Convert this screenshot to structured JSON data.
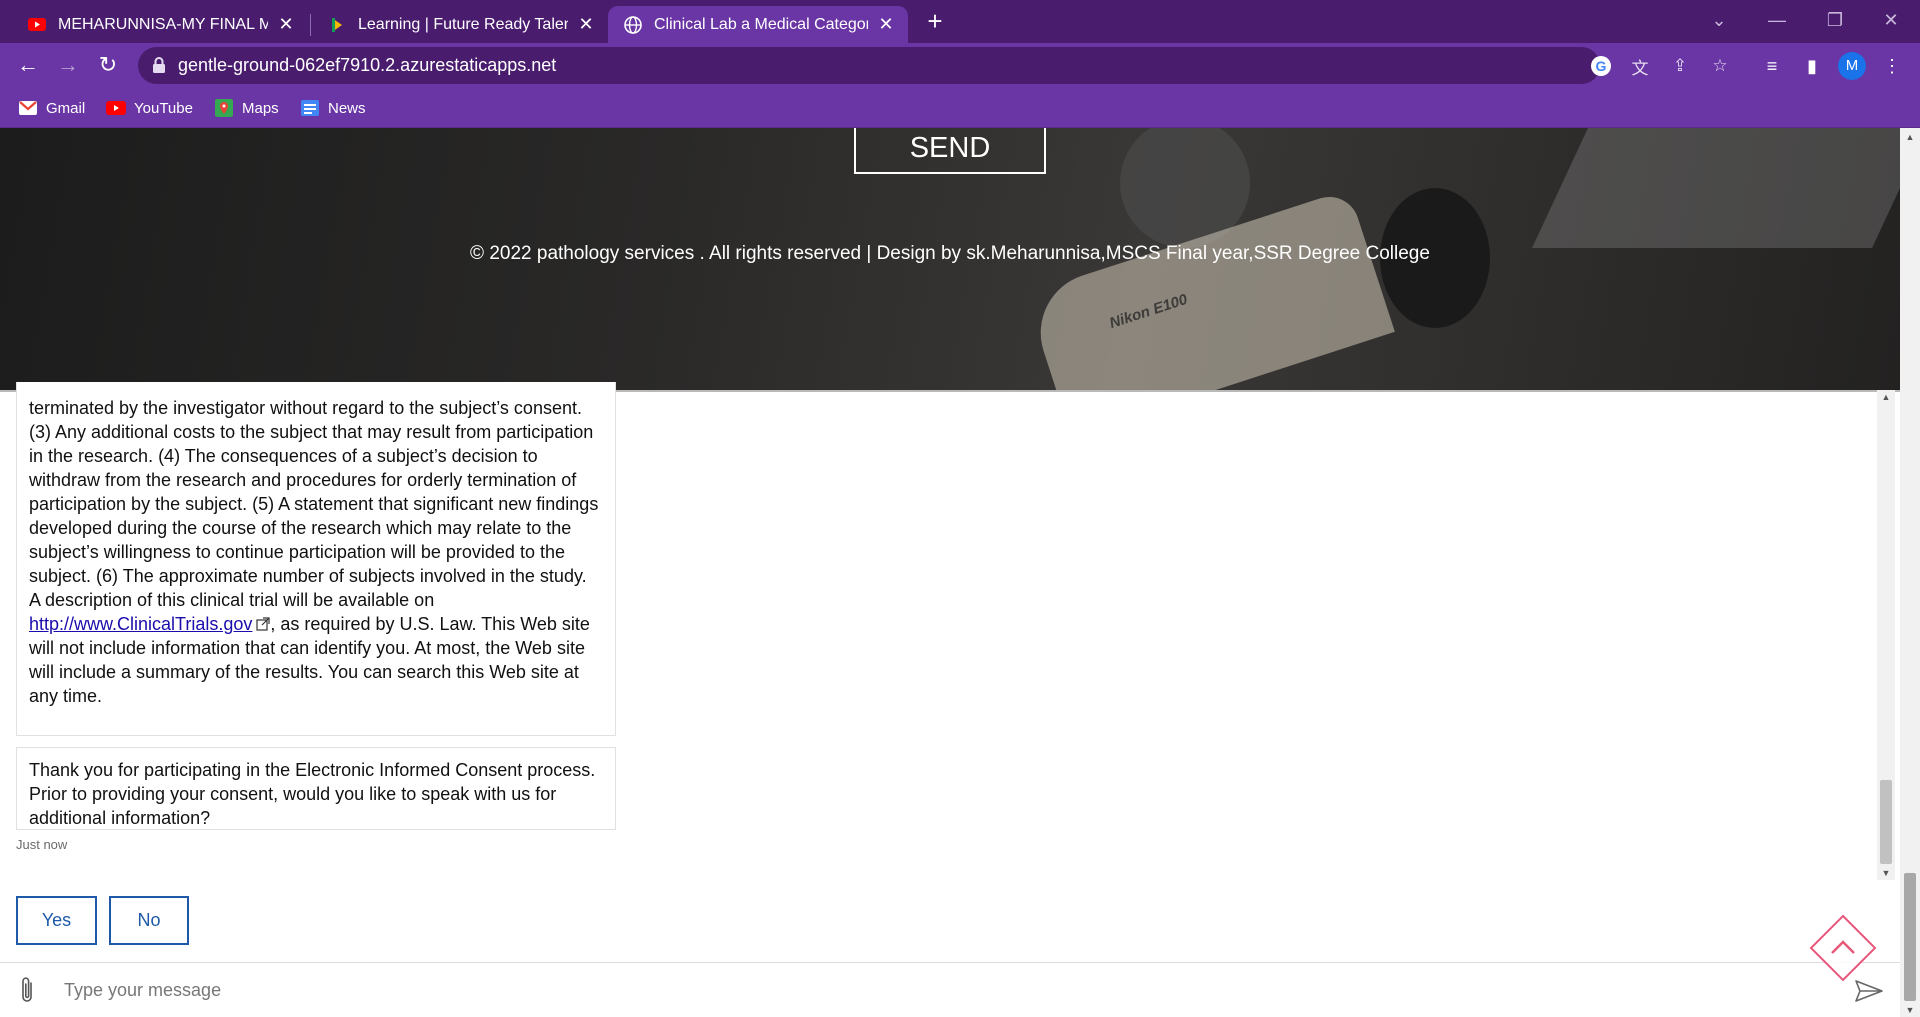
{
  "browser": {
    "tabs": [
      {
        "title": "MEHARUNNISA-MY FINAL MS CS",
        "icon": "youtube-icon",
        "active": false
      },
      {
        "title": "Learning | Future Ready Talent",
        "icon": "learning-icon",
        "active": false
      },
      {
        "title": "Clinical Lab a Medical Category F",
        "icon": "globe-icon",
        "active": true
      }
    ],
    "new_tab_symbol": "+",
    "url": "gentle-ground-062ef7910.2.azurestaticapps.net",
    "profile_initial": "M",
    "bookmarks": [
      {
        "label": "Gmail",
        "icon": "gmail-icon"
      },
      {
        "label": "YouTube",
        "icon": "youtube-icon"
      },
      {
        "label": "Maps",
        "icon": "maps-icon"
      },
      {
        "label": "News",
        "icon": "news-icon"
      }
    ]
  },
  "hero": {
    "send_label": "SEND",
    "brand_text": "Nikon E100",
    "footer_text": "© 2022 pathology services . All rights reserved | Design by sk.Meharunnisa,MSCS Final year,SSR Degree College"
  },
  "chat": {
    "message1": {
      "before_link": "terminated by the investigator without regard to the subject’s consent. (3) Any additional costs to the subject that may result from participation in the research. (4) The consequences of a subject’s decision to withdraw from the research and procedures for orderly termination of participation by the subject. (5) A statement that significant new findings developed during the course of the research which may relate to the subject’s willingness to continue participation will be provided to the subject. (6) The approximate number of subjects involved in the study.",
      "description_intro": "A description of this clinical trial will be available on",
      "link_text": "http://www.ClinicalTrials.gov",
      "after_link": ", as required by U.S. Law. This Web site will not include information that can identify you. At most, the Web site will include a summary of the results. You can search this Web site at any time."
    },
    "message2": "Thank you for participating in the Electronic Informed Consent process. Prior to providing your consent, would you like to speak with us for additional information?",
    "timestamp": "Just now",
    "suggestions": [
      "Yes",
      "No"
    ],
    "input_placeholder": "Type your message"
  },
  "colors": {
    "tabstrip": "#4a1c6e",
    "toolbar": "#6a35a4",
    "suggestion_border": "#1e5aa8",
    "back_to_top": "#e8577a"
  }
}
